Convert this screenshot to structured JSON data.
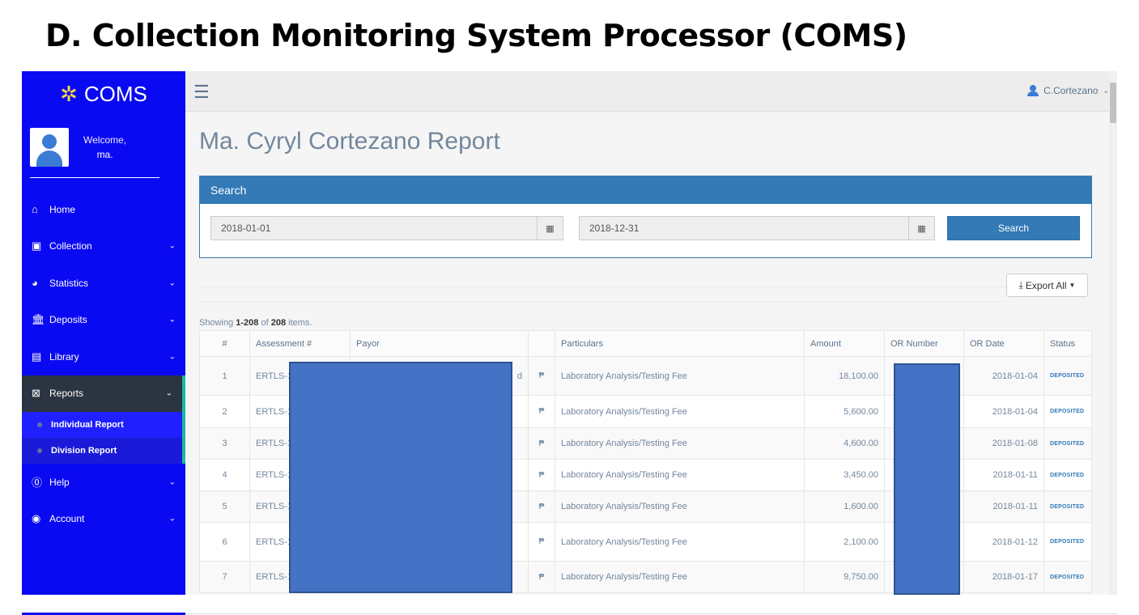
{
  "heading": "D. Collection Monitoring System Processor (COMS)",
  "sidebar": {
    "brand": "COMS",
    "welcome": "Welcome,",
    "username": "ma.",
    "items": [
      {
        "label": "Home",
        "icon": "home-icon"
      },
      {
        "label": "Collection",
        "icon": "money-icon"
      },
      {
        "label": "Statistics",
        "icon": "pie-chart-icon"
      },
      {
        "label": "Deposits",
        "icon": "bank-icon"
      },
      {
        "label": "Library",
        "icon": "book-icon"
      },
      {
        "label": "Reports",
        "icon": "excel-file-icon"
      },
      {
        "label": "Help",
        "icon": "question-circle-icon"
      },
      {
        "label": "Account",
        "icon": "user-circle-icon"
      }
    ],
    "reports_sub": [
      "Individual Report",
      "Division Report"
    ]
  },
  "topbar": {
    "user": "C.Cortezano"
  },
  "main": {
    "title": "Ma. Cyryl Cortezano Report",
    "search_panel_title": "Search",
    "date_from": "2018-01-01",
    "date_to": "2018-12-31",
    "search_button": "Search",
    "export_button": "Export All",
    "summary": {
      "prefix": "Showing ",
      "range": "1-208",
      "mid": " of ",
      "total": "208",
      "suffix": " items."
    }
  },
  "table": {
    "headers": [
      "#",
      "Assessment #",
      "Payor",
      "",
      "Particulars",
      "Amount",
      "OR Number",
      "OR Date",
      "Status"
    ],
    "rows": [
      {
        "num": "1",
        "assessment": "ERTLS-1",
        "payor": "d",
        "peso": "₱",
        "particulars": "Laboratory Analysis/Testing Fee",
        "amount": "18,100.00",
        "or_date": "2018-01-04",
        "status": "DEPOSITED"
      },
      {
        "num": "2",
        "assessment": "ERTLS-1",
        "payor": "",
        "peso": "₱",
        "particulars": "Laboratory Analysis/Testing Fee",
        "amount": "5,600.00",
        "or_date": "2018-01-04",
        "status": "DEPOSITED"
      },
      {
        "num": "3",
        "assessment": "ERTLS-1",
        "payor": "",
        "peso": "₱",
        "particulars": "Laboratory Analysis/Testing Fee",
        "amount": "4,600.00",
        "or_date": "2018-01-08",
        "status": "DEPOSITED"
      },
      {
        "num": "4",
        "assessment": "ERTLS-1",
        "payor": "",
        "peso": "₱",
        "particulars": "Laboratory Analysis/Testing Fee",
        "amount": "3,450.00",
        "or_date": "2018-01-11",
        "status": "DEPOSITED"
      },
      {
        "num": "5",
        "assessment": "ERTLS-1",
        "payor": "",
        "peso": "₱",
        "particulars": "Laboratory Analysis/Testing Fee",
        "amount": "1,600.00",
        "or_date": "2018-01-11",
        "status": "DEPOSITED"
      },
      {
        "num": "6",
        "assessment": "ERTLS-1",
        "payor": "",
        "peso": "₱",
        "particulars": "Laboratory Analysis/Testing Fee",
        "amount": "2,100.00",
        "or_date": "2018-01-12",
        "status": "DEPOSITED"
      },
      {
        "num": "7",
        "assessment": "ERTLS-1",
        "payor": "",
        "peso": "₱",
        "particulars": "Laboratory Analysis/Testing Fee",
        "amount": "9,750.00",
        "or_date": "2018-01-17",
        "status": "DEPOSITED"
      }
    ]
  }
}
